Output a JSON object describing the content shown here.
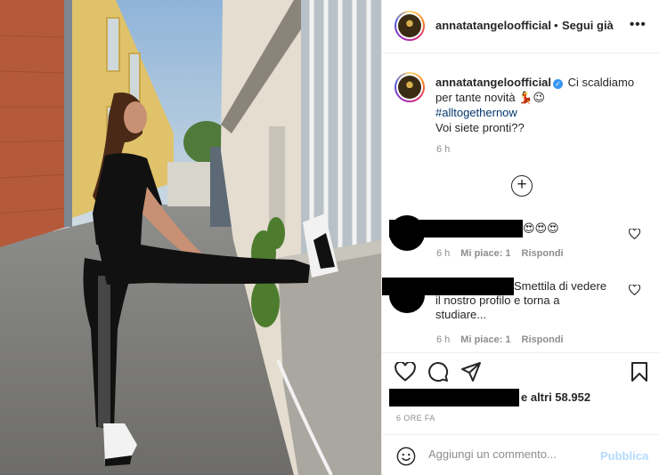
{
  "post": {
    "username": "annatatangeloofficial",
    "separator": "•",
    "follow_label": "Segui già",
    "more_label": "•••"
  },
  "caption": {
    "username": "annatatangeloofficial",
    "line1": "Ci scaldiamo per tante novità 💃😉",
    "hashtag": "#alltogethernow",
    "line3": "Voi siete pronti??",
    "time": "6 h"
  },
  "load_more_label": "+",
  "comments": [
    {
      "text": "😍😍😍",
      "time": "6 h",
      "likes": "Mi piace: 1",
      "reply": "Rispondi"
    },
    {
      "text_line1": "Smettila di vedere",
      "text_line2": "il nostro profilo e torna a",
      "text_line3": "studiare...",
      "time": "6 h",
      "likes": "Mi piace: 1",
      "reply": "Rispondi"
    }
  ],
  "likes": {
    "text": "e altri 58.952"
  },
  "date": "6 ORE FA",
  "add_comment": {
    "placeholder": "Aggiungi un commento...",
    "publish_label": "Pubblica"
  },
  "icons": [
    "heart-icon",
    "comment-icon",
    "share-icon",
    "bookmark-icon",
    "emoji-icon",
    "verified-icon",
    "more-icon",
    "plus-circle-icon"
  ],
  "colors": {
    "link": "#00376b",
    "verified": "#3897f0",
    "publish_disabled": "#b3dbff",
    "meta_grey": "#8e8e8e"
  }
}
